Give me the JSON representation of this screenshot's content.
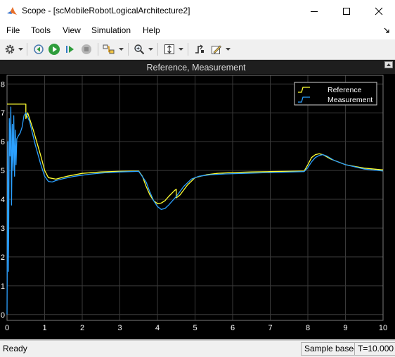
{
  "window": {
    "title": "Scope - [scMobileRobotLogicalArchitecture2]",
    "minimize_icon": "minimize-icon",
    "maximize_icon": "maximize-icon",
    "close_icon": "close-icon"
  },
  "menu": {
    "items": [
      "File",
      "Tools",
      "View",
      "Simulation",
      "Help"
    ]
  },
  "toolbar": {
    "icons": [
      "settings-gear-icon",
      "step-back-icon",
      "run-icon",
      "step-forward-icon",
      "stop-icon",
      "signal-highlight-icon",
      "zoom-icon",
      "autoscale-icon",
      "triggers-icon",
      "style-icon"
    ]
  },
  "colors": {
    "plot_background": "#000000",
    "axes_text": "#ffffff",
    "title_bar_plot": "#1a1a1a",
    "reference": "#ffff32",
    "measurement": "#2ba0ff",
    "grid": "#3a3a3a"
  },
  "chart_data": {
    "type": "line",
    "title": "Reference, Measurement",
    "xlabel": "",
    "ylabel": "",
    "xlim": [
      0,
      10
    ],
    "ylim": [
      -0.2,
      8.3
    ],
    "xticks": [
      "0",
      "1",
      "2",
      "3",
      "4",
      "5",
      "6",
      "7",
      "8",
      "9",
      "10"
    ],
    "yticks": [
      "0",
      "1",
      "2",
      "3",
      "4",
      "5",
      "6",
      "7",
      "8"
    ],
    "grid": true,
    "legend_position": "top-right",
    "series": [
      {
        "name": "Reference",
        "color": "#ffff32",
        "x": [
          0,
          0.5,
          0.5,
          0.55,
          0.7,
          0.9,
          1.0,
          1.1,
          1.3,
          1.6,
          2.0,
          2.5,
          3.0,
          3.5,
          3.6,
          3.7,
          3.8,
          3.9,
          4.0,
          4.1,
          4.2,
          4.3,
          4.45,
          4.5,
          4.5,
          4.6,
          4.8,
          5.0,
          5.3,
          5.6,
          6.0,
          6.5,
          7.0,
          7.5,
          7.9,
          8.0,
          8.1,
          8.2,
          8.3,
          8.4,
          8.6,
          9.0,
          9.5,
          10.0
        ],
        "y": [
          7.3,
          7.3,
          6.8,
          7.0,
          6.4,
          5.5,
          5.0,
          4.75,
          4.7,
          4.8,
          4.9,
          4.95,
          4.97,
          4.98,
          4.8,
          4.45,
          4.15,
          3.95,
          3.85,
          3.87,
          3.95,
          4.1,
          4.3,
          4.35,
          4.05,
          4.15,
          4.5,
          4.75,
          4.85,
          4.9,
          4.93,
          4.95,
          4.96,
          4.97,
          4.98,
          5.2,
          5.45,
          5.55,
          5.58,
          5.55,
          5.4,
          5.2,
          5.08,
          5.02
        ]
      },
      {
        "name": "Measurement",
        "color": "#2ba0ff",
        "x": [
          0,
          0.02,
          0.04,
          0.06,
          0.08,
          0.1,
          0.12,
          0.14,
          0.16,
          0.18,
          0.2,
          0.22,
          0.24,
          0.26,
          0.3,
          0.35,
          0.4,
          0.45,
          0.5,
          0.6,
          0.75,
          0.9,
          1.0,
          1.1,
          1.2,
          1.3,
          1.5,
          1.8,
          2.2,
          2.6,
          3.0,
          3.5,
          3.7,
          3.8,
          3.9,
          4.0,
          4.1,
          4.2,
          4.3,
          4.5,
          4.7,
          4.9,
          5.1,
          5.4,
          5.8,
          6.3,
          6.8,
          7.3,
          7.9,
          8.0,
          8.1,
          8.2,
          8.3,
          8.4,
          8.5,
          8.7,
          9.0,
          9.5,
          10.0
        ],
        "y": [
          0,
          6.0,
          1.5,
          6.8,
          5.5,
          7.2,
          3.8,
          6.6,
          5.0,
          6.9,
          4.8,
          6.4,
          5.2,
          6.1,
          6.2,
          6.3,
          6.5,
          6.9,
          7.0,
          6.7,
          5.9,
          5.2,
          4.8,
          4.62,
          4.6,
          4.65,
          4.72,
          4.8,
          4.87,
          4.92,
          4.95,
          4.97,
          4.6,
          4.25,
          3.95,
          3.75,
          3.65,
          3.68,
          3.8,
          4.1,
          4.45,
          4.7,
          4.8,
          4.85,
          4.88,
          4.9,
          4.92,
          4.94,
          4.96,
          5.1,
          5.3,
          5.45,
          5.52,
          5.55,
          5.5,
          5.35,
          5.2,
          5.05,
          4.98
        ]
      }
    ]
  },
  "status": {
    "state": "Ready",
    "sample_mode": "Sample based",
    "time": "T=10.000"
  }
}
